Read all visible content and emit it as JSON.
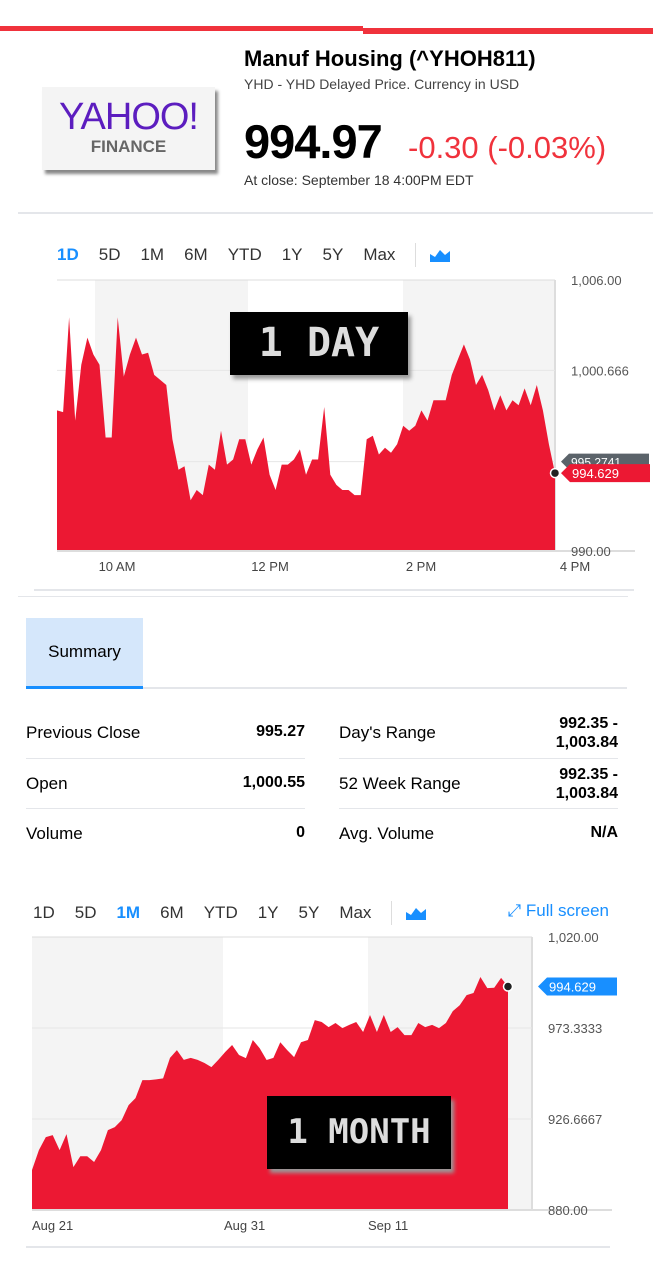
{
  "header": {
    "title": "Manuf Housing (^YHOH811)",
    "subtitle": "YHD - YHD Delayed Price. Currency in USD",
    "price": "994.97",
    "change": "-0.30 (-0.03%)",
    "close_time": "At close: September 18 4:00PM EDT",
    "logo_main": "YAHOO!",
    "logo_sub": "FINANCE"
  },
  "colors": {
    "accent": "#188fff",
    "negative": "#f0323c",
    "area": "#ec1833",
    "brand": "#5c1dbf"
  },
  "range_tabs": [
    "1D",
    "5D",
    "1M",
    "6M",
    "YTD",
    "1Y",
    "5Y",
    "Max"
  ],
  "chart_type_icon": "area-chart-icon",
  "full_screen": "Full screen",
  "summary_tab": "Summary",
  "stats": {
    "left": [
      {
        "label": "Previous Close",
        "value": "995.27"
      },
      {
        "label": "Open",
        "value": "1,000.55"
      },
      {
        "label": "Volume",
        "value": "0"
      }
    ],
    "right": [
      {
        "label": "Day's Range",
        "value": "992.35 -\n1,003.84"
      },
      {
        "label": "52 Week Range",
        "value": "992.35 -\n1,003.84"
      },
      {
        "label": "Avg. Volume",
        "value": "N/A"
      }
    ]
  },
  "chart_data": [
    {
      "type": "area",
      "selected_range": "1D",
      "overlay_text": "1 DAY",
      "ylim": [
        990,
        1006
      ],
      "y_ticks": [
        "1,006.00",
        "1,000.666",
        "990.00"
      ],
      "x_ticks": [
        "10 AM",
        "12 PM",
        "2 PM",
        "4 PM"
      ],
      "previous_close_tag": "995.2741",
      "current_tag": "994.629",
      "values": [
        998.3,
        998.2,
        1003.8,
        997.7,
        1001.0,
        1002.6,
        1001.6,
        1001.0,
        996.7,
        996.7,
        1003.8,
        1000.3,
        1001.6,
        1002.6,
        1001.6,
        1001.7,
        1000.4,
        1000.1,
        999.8,
        996.6,
        994.8,
        995.0,
        993.0,
        993.6,
        993.3,
        995.1,
        994.8,
        997.1,
        995.1,
        995.4,
        996.6,
        996.6,
        995.1,
        996.0,
        996.7,
        994.5,
        993.6,
        995.1,
        995.1,
        995.4,
        996.0,
        994.5,
        995.4,
        995.4,
        998.5,
        994.5,
        993.9,
        993.6,
        993.6,
        993.3,
        993.3,
        996.6,
        996.8,
        995.7,
        996.1,
        995.8,
        996.3,
        997.4,
        997.1,
        997.4,
        998.3,
        997.7,
        998.9,
        998.9,
        998.9,
        1000.4,
        1001.3,
        1002.2,
        1001.3,
        999.8,
        1000.4,
        999.5,
        998.3,
        999.2,
        998.3,
        998.9,
        998.6,
        999.6,
        998.6,
        999.8,
        998.3,
        996.3,
        994.6
      ]
    },
    {
      "type": "area",
      "selected_range": "1M",
      "overlay_text": "1 MONTH",
      "ylim": [
        880,
        1020
      ],
      "y_ticks": [
        "1,020.00",
        "973.3333",
        "926.6667",
        "880.00"
      ],
      "x_ticks": [
        "Aug 21",
        "Aug 31",
        "Sep 11"
      ],
      "current_tag": "994.629",
      "values": [
        900.5,
        910.7,
        917.4,
        918.4,
        910.7,
        918.9,
        902,
        907.6,
        907.6,
        904.6,
        910.7,
        921,
        922.5,
        926.1,
        933.8,
        937.4,
        946.6,
        946.6,
        947,
        947.5,
        958,
        962,
        957,
        958,
        957,
        955.4,
        953.3,
        957,
        961,
        964.6,
        959.5,
        957.9,
        967.2,
        963,
        956.9,
        958,
        966,
        962,
        958.4,
        966,
        967.2,
        977.4,
        976.4,
        973.8,
        975.9,
        973.3,
        974.9,
        976.4,
        971.3,
        980,
        971.3,
        980,
        971.3,
        973.8,
        969.7,
        969.7,
        975.9,
        973.8,
        974.9,
        973.3,
        975.9,
        982,
        985,
        990.2,
        991.3,
        999.5,
        993.8,
        994,
        999,
        994.6
      ]
    }
  ]
}
